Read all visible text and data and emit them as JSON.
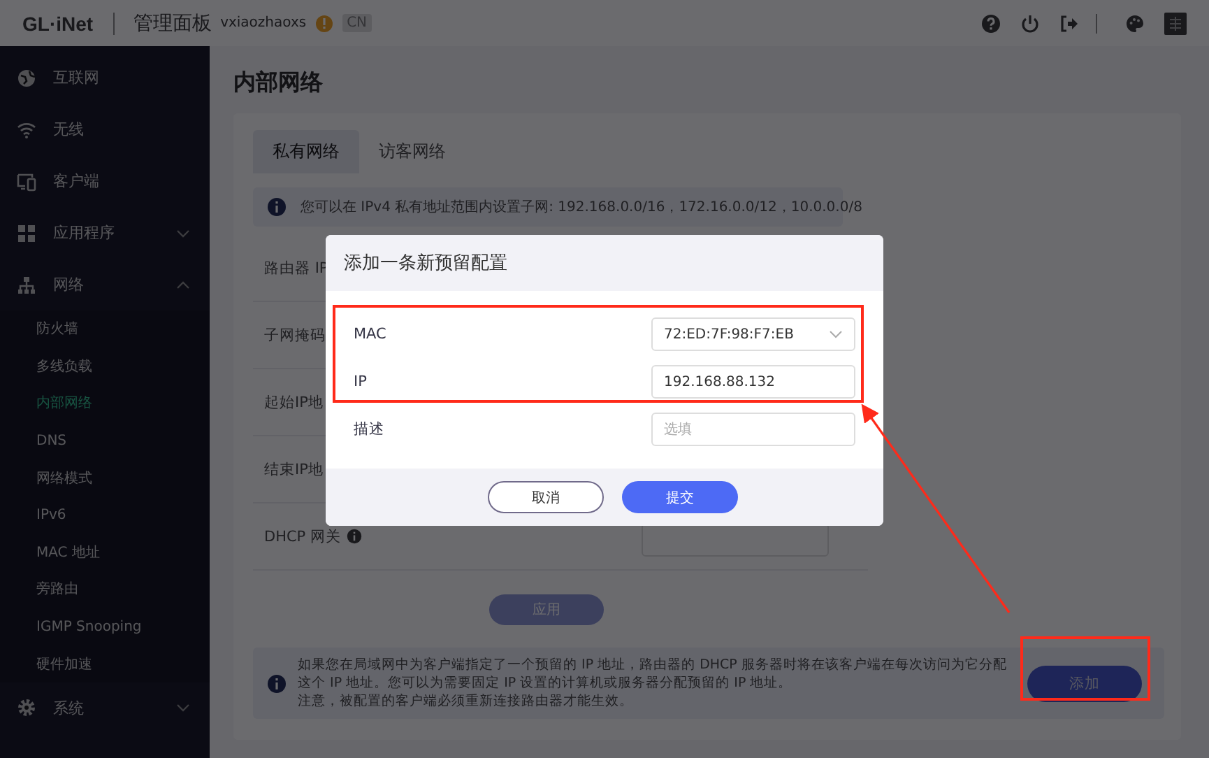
{
  "header": {
    "logo": "GL·iNet",
    "title": "管理面板",
    "username": "vxiaozhaoxs",
    "region": "CN"
  },
  "sidebar": {
    "items": [
      {
        "label": "互联网",
        "kind": "link"
      },
      {
        "label": "无线",
        "kind": "link"
      },
      {
        "label": "客户端",
        "kind": "link"
      },
      {
        "label": "应用程序",
        "kind": "group",
        "expanded": false
      },
      {
        "label": "网络",
        "kind": "group",
        "expanded": true,
        "children": [
          {
            "label": "防火墙",
            "selected": false
          },
          {
            "label": "多线负载",
            "selected": false
          },
          {
            "label": "内部网络",
            "selected": true
          },
          {
            "label": "DNS",
            "selected": false
          },
          {
            "label": "网络模式",
            "selected": false
          },
          {
            "label": "IPv6",
            "selected": false
          },
          {
            "label": "MAC 地址",
            "selected": false
          },
          {
            "label": "旁路由",
            "selected": false
          },
          {
            "label": "IGMP Snooping",
            "selected": false
          },
          {
            "label": "硬件加速",
            "selected": false
          }
        ]
      },
      {
        "label": "系统",
        "kind": "group",
        "expanded": false
      }
    ]
  },
  "page": {
    "title": "内部网络",
    "tabs": [
      {
        "label": "私有网络",
        "selected": true
      },
      {
        "label": "访客网络",
        "selected": false
      }
    ],
    "info": "您可以在 IPv4 私有地址范围内设置子网: 192.168.0.0/16，172.16.0.0/12，10.0.0.0/8",
    "form_labels": [
      "路由器 IP",
      "子网掩码",
      "起始IP地",
      "结束IP地",
      "DHCP 网关"
    ],
    "apply_button": "应用",
    "note_lines": [
      "如果您在局域网中为客户端指定了一个预留的 IP 地址，路由器的 DHCP 服务器时将在该客户端在每次访问为它分配这个 IP 地址。您可以为需要固定 IP 设置的计算机或服务器分配预留的 IP 地址。",
      "注意，被配置的客户端必须重新连接路由器才能生效。"
    ],
    "add_button": "添加"
  },
  "dialog": {
    "title": "添加一条新预留配置",
    "fields": [
      {
        "label": "MAC",
        "kind": "select",
        "value": "72:ED:7F:98:F7:EB"
      },
      {
        "label": "IP",
        "kind": "text",
        "value": "192.168.88.132"
      },
      {
        "label": "描述",
        "kind": "text",
        "placeholder": "选填"
      }
    ],
    "buttons": [
      {
        "label": "取消",
        "kind": "secondary"
      },
      {
        "label": "提交",
        "kind": "primary"
      }
    ]
  }
}
